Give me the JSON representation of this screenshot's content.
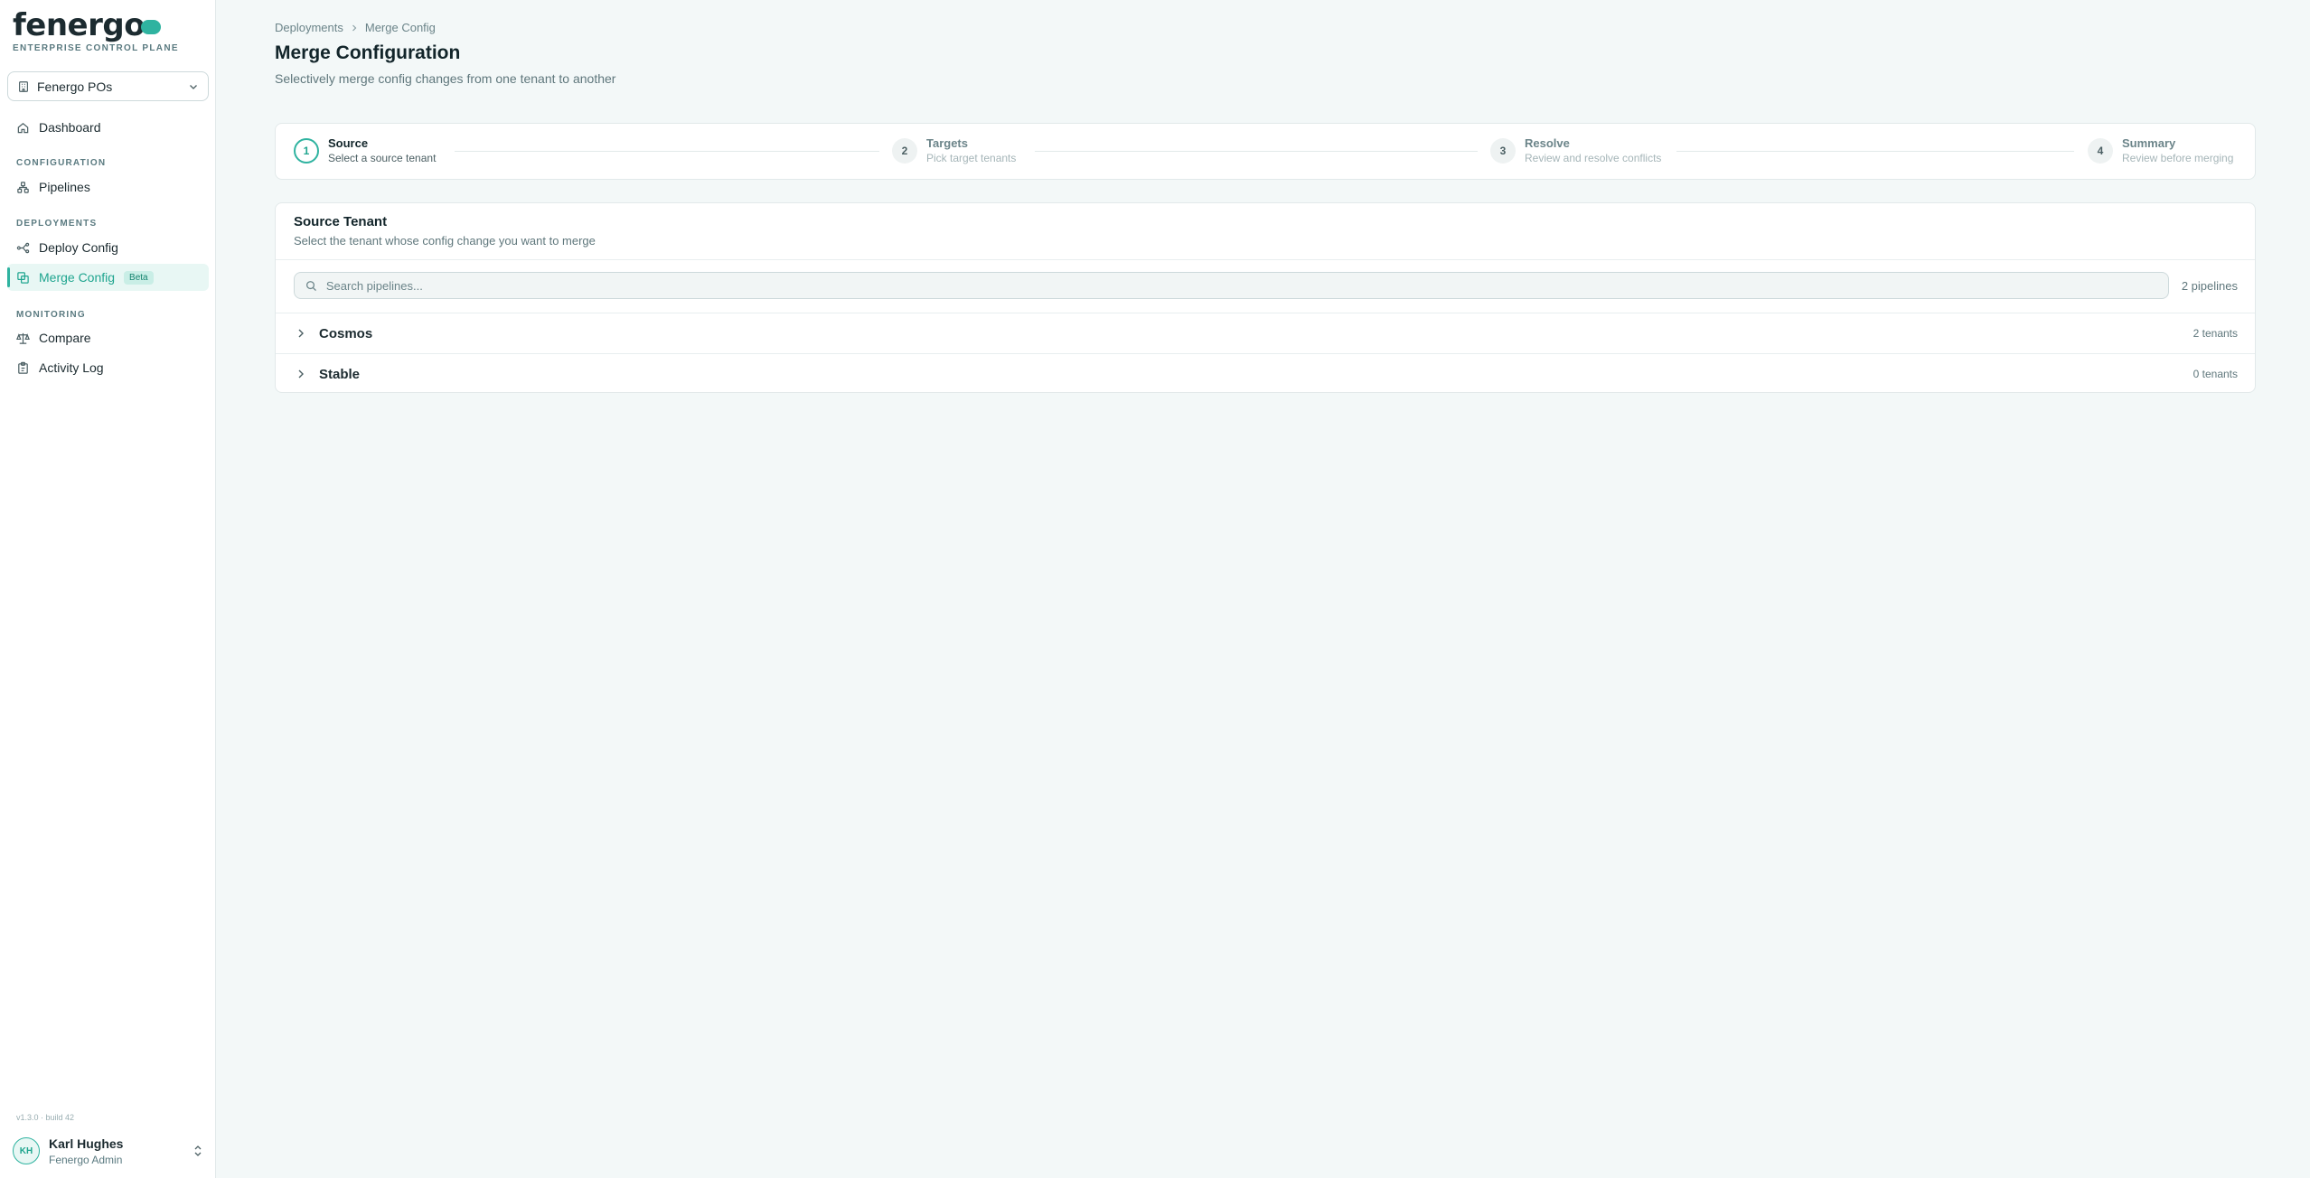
{
  "brand": {
    "name": "fenergo",
    "tagline": "ENTERPRISE CONTROL PLANE"
  },
  "org_select": {
    "value": "Fenergo POs"
  },
  "sidebar": {
    "dashboard": "Dashboard",
    "sections": {
      "configuration": "CONFIGURATION",
      "deployments": "DEPLOYMENTS",
      "monitoring": "MONITORING"
    },
    "pipelines": "Pipelines",
    "deploy_config": "Deploy Config",
    "merge_config": "Merge Config",
    "merge_badge": "Beta",
    "compare": "Compare",
    "activity_log": "Activity Log",
    "version": "v1.3.0 · build 42"
  },
  "user": {
    "initials": "KH",
    "name": "Karl Hughes",
    "role": "Fenergo Admin"
  },
  "breadcrumb": {
    "parent": "Deployments",
    "current": "Merge Config"
  },
  "page": {
    "title": "Merge Configuration",
    "subtitle": "Selectively merge config changes from one tenant to another"
  },
  "steps": [
    {
      "num": "1",
      "title": "Source",
      "desc": "Select a source tenant"
    },
    {
      "num": "2",
      "title": "Targets",
      "desc": "Pick target tenants"
    },
    {
      "num": "3",
      "title": "Resolve",
      "desc": "Review and resolve conflicts"
    },
    {
      "num": "4",
      "title": "Summary",
      "desc": "Review before merging"
    }
  ],
  "source_card": {
    "title": "Source Tenant",
    "subtitle": "Select the tenant whose config change you want to merge",
    "search_placeholder": "Search pipelines...",
    "pipeline_count": "2 pipelines",
    "rows": [
      {
        "name": "Cosmos",
        "count": "2 tenants"
      },
      {
        "name": "Stable",
        "count": "0 tenants"
      }
    ]
  },
  "colors": {
    "accent": "#2fb3a0",
    "background": "#f3f8f8"
  }
}
